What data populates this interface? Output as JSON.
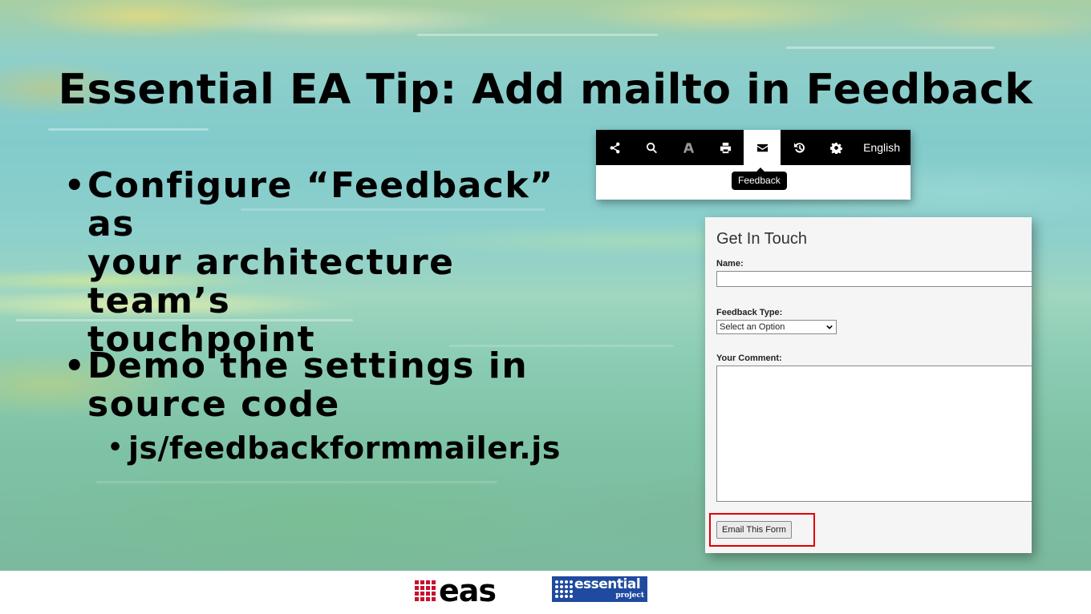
{
  "slide": {
    "title": "Essential EA Tip: Add mailto in Feedback",
    "bullets": [
      {
        "text": "Configure “Feedback” as your architecture team’s touchpoint",
        "lines": [
          "Configure “Feedback” as",
          "your architecture team’s",
          "touchpoint"
        ]
      },
      {
        "text": "Demo the settings in source code",
        "lines": [
          "Demo the settings in",
          "source code"
        ],
        "sub_bullets": [
          "js/feedbackformmailer.js"
        ]
      }
    ],
    "bullet_glyph": "•"
  },
  "toolbar": {
    "icons": [
      "share-icon",
      "search-icon",
      "font-icon",
      "print-icon",
      "envelope-icon",
      "history-icon",
      "gear-icon"
    ],
    "active_icon": "envelope-icon",
    "language": "English",
    "tooltip": "Feedback"
  },
  "form": {
    "title": "Get In Touch",
    "name_label": "Name:",
    "name_value": "",
    "feedback_type_label": "Feedback Type:",
    "feedback_type_selected": "Select an Option",
    "comment_label": "Your Comment:",
    "comment_value": "",
    "submit_label": "Email This Form",
    "highlight_color": "#e00000"
  },
  "footer": {
    "logo_left": "eas",
    "logo_right_main": "essential",
    "logo_right_sub": "project",
    "accent_red": "#c8102e",
    "accent_blue": "#1f4aa0"
  }
}
